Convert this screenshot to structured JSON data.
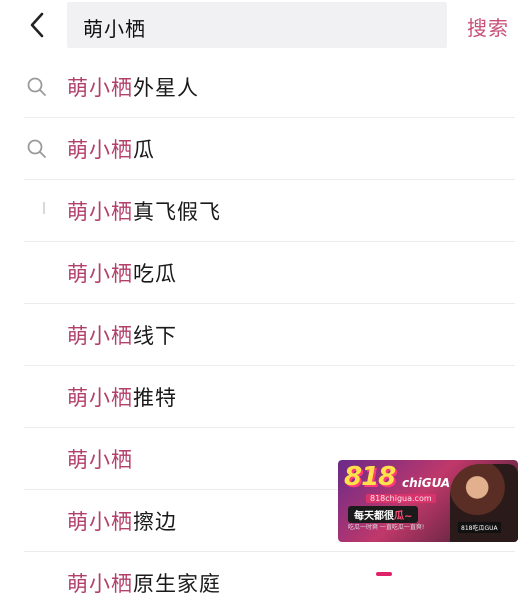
{
  "header": {
    "query": "萌小栖",
    "search_label": "搜索"
  },
  "suggestions": [
    {
      "prefix": "萌小栖",
      "rest": "外星人",
      "icon": "search-icon"
    },
    {
      "prefix": "萌小栖",
      "rest": "瓜",
      "icon": "search-icon"
    },
    {
      "prefix": "萌小栖",
      "rest": "真飞假飞",
      "icon": ""
    },
    {
      "prefix": "萌小栖",
      "rest": "吃瓜",
      "icon": ""
    },
    {
      "prefix": "萌小栖",
      "rest": "线下",
      "icon": ""
    },
    {
      "prefix": "萌小栖",
      "rest": "推特",
      "icon": ""
    },
    {
      "prefix": "萌小栖",
      "rest": "",
      "icon": ""
    },
    {
      "prefix": "萌小栖",
      "rest": "擦边",
      "icon": ""
    },
    {
      "prefix": "萌小栖",
      "rest": "原生家庭",
      "icon": ""
    }
  ],
  "ad": {
    "brand": "818",
    "brand_suffix": "chiGUA",
    "url": "818chigua.com",
    "slogan_a": "每天都很",
    "slogan_b": "瓜~",
    "tagline": "吃瓜一时爽 一直吃瓜一直爽!",
    "badge": "818吃瓜GUA"
  },
  "colors": {
    "accent": "#c8507a",
    "highlight": "#b3406a",
    "searchbox_bg": "#f1f1f3"
  }
}
